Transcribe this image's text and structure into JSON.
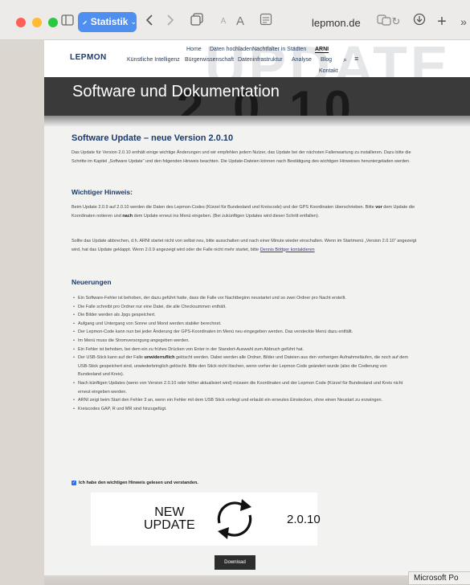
{
  "browser": {
    "tab_group_label": "Statistik",
    "address": "lepmon.de",
    "icons": [
      "sidebar-icon",
      "back-icon",
      "forward-icon",
      "tabs-overview-icon",
      "text-size-small-icon",
      "text-size-large-icon",
      "reader-icon",
      "translate-icon",
      "reload-icon",
      "download-icon",
      "new-tab-icon",
      "more-icon"
    ]
  },
  "site": {
    "logo": "LEPMON",
    "nav_top": [
      "Home",
      "Daten hochladen",
      "Nachtfalter in Städten",
      "ARNI"
    ],
    "nav_main": [
      "Künstliche Intelligenz",
      "Bürgerwissenschaft",
      "Dateninfrastruktur",
      "Analyse",
      "Blog",
      "Kontakt"
    ],
    "hero_title": "Software und Dokumentation",
    "hero_watermark": "UPDATE",
    "hero_digits": "2.0.10"
  },
  "article": {
    "title": "Software Update – neue Version 2.0.10",
    "intro": "Das Update für Version 2.0.10 enthält einige wichtige Änderungen und wir empfehlen jedem Nutzer, das Update bei der nächsten Fallenwartung zu installieren. Dazu bitte die Schritte im Kapitel „Software Update“ und den folgenden Hinweis beachten. Die Update-Dateien können nach Bestätigung des wichtigen Hinweises heruntergeladen werden.",
    "notice_title": "Wichtiger Hinweis:",
    "notice_p1_a": "Beim Update 2.0.9 auf 2.0.10 werden die Daten des Lepmon-Codes (Kürzel für Bundesland und Kreiscode) und der GPS Koordinaten überschrieben. Bitte ",
    "notice_p1_b1": "vor",
    "notice_p1_c": " dem Update die Koordinaten notieren und ",
    "notice_p1_b2": "nach",
    "notice_p1_d": " dem Update erneut ins Menü eingeben. (Bei zukünftigen Updates wird dieser Schritt entfallen).",
    "notice_p2": "Sollte das Update abbrechen, d.h. ARNI startet nicht von selbst neu, bitte ausschalten und nach einer Minute wieder einschalten. Wenn im Startmenü „Version 2.0.10“ angezeigt wird, hat das Update geklappt. Wenn 2.0.9 angezeigt wird oder die Falle nicht mehr startet, bitte ",
    "notice_link": "Dennis Böttger kontaktieren",
    "news_title": "Neuerungen",
    "features": [
      "Ein Software-Fehler ist behoben, der dazu geführt hatte, dass die Falle vor Nachtbeginn neustartet und so zwei Ordner pro Nacht erstellt.",
      "Die Falle schreibt pro Ordner nur eine Datei, die alle Checksummen enthält.",
      "Die Bilder werden als Jpgs gespeichert.",
      "Aufgang und Untergang von Sonne und Mond werden stabiler berechnet.",
      "Der Lepmon-Code kann nun bei jeder Änderung der GPS-Koordinaten im Menü neu eingegeben werden. Das versteckte Menü dazu entfällt.",
      "Im Menü muss die Stromversorgung angegeben werden.",
      "Ein Fehler ist behoben, bei dem ein zu frühes Drücken von Enter in der Standort-Auswahl zum Abbruch geführt hat.",
      "__USB__",
      "Nach künftigen Updates (wenn von Version 2.0.10 oder höher aktualisiert wird) müssen die Koordinaten und der Lepmon Code (Kürzel für Bundesland und Kreis nicht erneut eingeben werden.",
      "ARNI zeigt beim Start den Fehler 3 an, wenn ein Fehler mit dem USB Stick vorliegt und erlaubt ein erneutes Einstecken, ohne einen Neustart zu erzwingen.",
      "Kreiscodes GAP, R und MR sind hinzugefügt."
    ],
    "usb_a": "Der USB-Stick kann auf der Falle ",
    "usb_b": "unwiderruflich",
    "usb_c": " gelöscht werden. Dabei werden alle Ordner, Bilder und Dateien aus den vorherigen Aufnahmeläufen, die noch auf dem USB-Stick gespeichert sind, unwiederbringlich gelöscht. Bitte den Stick nicht löschen, wenn vorher der Lepmon Code geändert wurde (also die Codierung von Bundesland und Kreis).",
    "confirm_label": "Ich habe den wichtigen Hinweis gelesen und verstanden.",
    "banner_new": "NEW",
    "banner_update": "UPDATE",
    "banner_version": "2.0.10",
    "download_label": "Download"
  },
  "dock": {
    "app_label": "Microsoft Po"
  },
  "colors": {
    "accent": "#1b3a6b",
    "tab_group": "#4f8ff0",
    "link": "#4a2d8f",
    "download_bg": "#2d2d2d"
  }
}
